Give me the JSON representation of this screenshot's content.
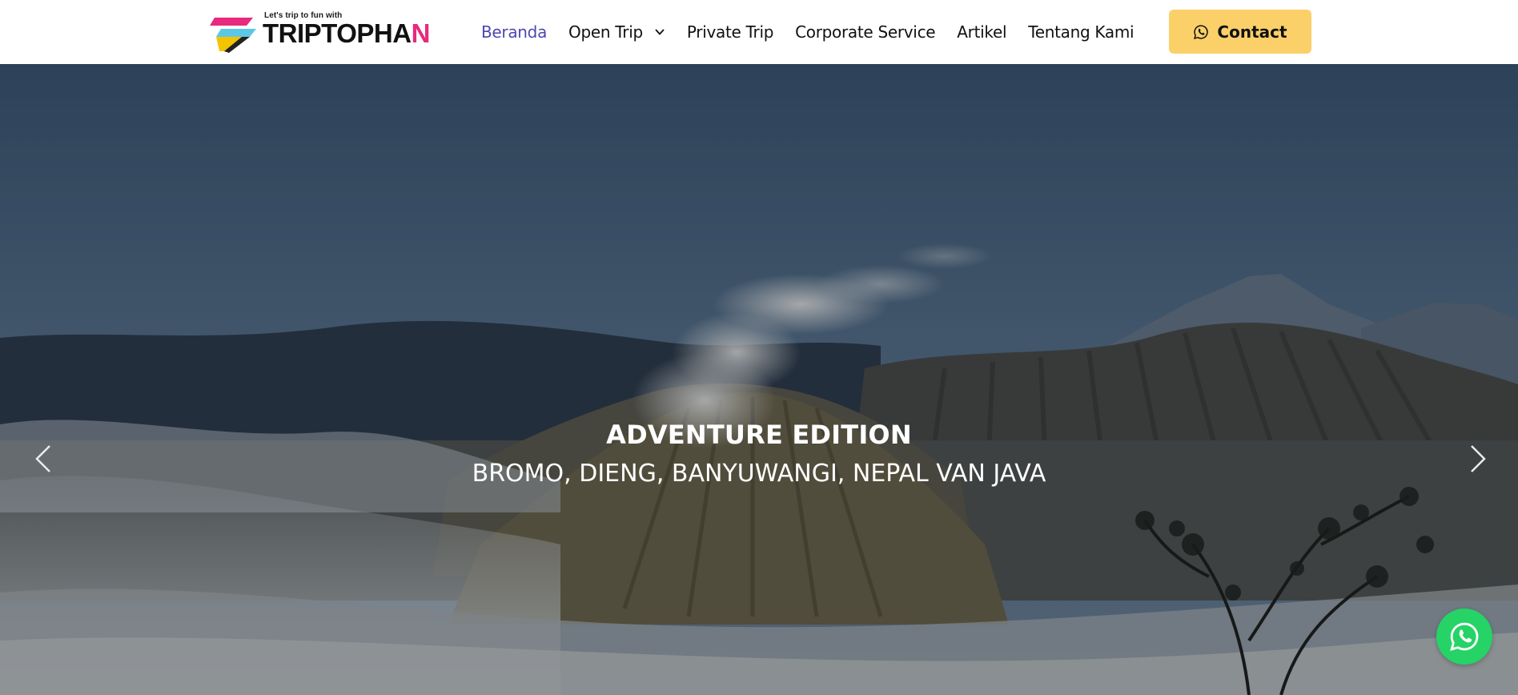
{
  "header": {
    "logo": {
      "tagline": "Let's trip to fun with",
      "word_main": "TRIPTOPHA",
      "word_accent": "N"
    },
    "nav": [
      {
        "label": "Beranda",
        "active": true
      },
      {
        "label": "Open Trip",
        "has_dropdown": true
      },
      {
        "label": "Private Trip"
      },
      {
        "label": "Corporate Service"
      },
      {
        "label": "Artikel"
      },
      {
        "label": "Tentang Kami"
      }
    ],
    "contact_label": "Contact"
  },
  "hero": {
    "title": "ADVENTURE EDITION",
    "subtitle": "BROMO, DIENG, BANYUWANGI, NEPAL VAN JAVA"
  },
  "icons": {
    "prev": "chevron-left-icon",
    "next": "chevron-right-icon",
    "whatsapp": "whatsapp-icon",
    "dropdown": "chevron-down-icon"
  },
  "colors": {
    "nav_active": "#4f46b0",
    "contact_button": "#fbd069",
    "whatsapp_green": "#25d366",
    "logo_accent_pink": "#e8297d",
    "logo_accent_yellow": "#f5c400"
  }
}
